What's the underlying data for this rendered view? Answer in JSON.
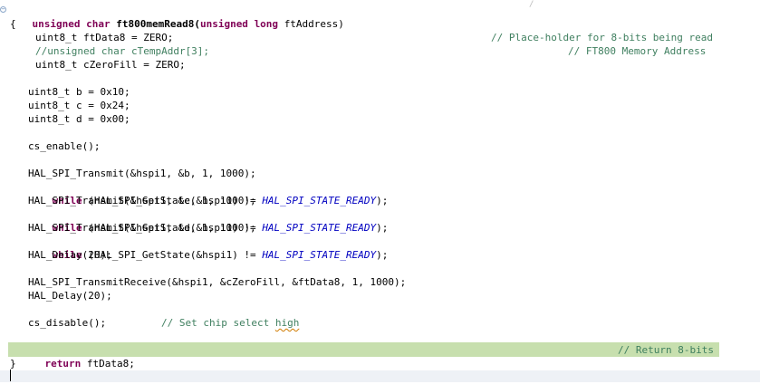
{
  "editor": {
    "fold_icon": "collapse-icon",
    "top_right_mark": "/",
    "signature": {
      "ret_kw": "unsigned",
      "ret_type": "char",
      "name": "ft800memRead8(",
      "param_kw1": "unsigned",
      "param_kw2": "long",
      "param_name": "ftAddress)"
    },
    "open_brace": "{",
    "close_brace": "}",
    "lines": {
      "l1_code": "uint8_t ftData8 = ZERO;",
      "l1_comment": "// Place-holder for 8-bits being read",
      "l2_comment_a": "//unsigned char cTempAddr[3];",
      "l2_comment_b": "// FT800 Memory Address",
      "l3_code": "uint8_t cZeroFill = ZERO;",
      "l4_code": "uint8_t b = 0x10;",
      "l5_code": "uint8_t c = 0x24;",
      "l6_code": "uint8_t d = 0x00;",
      "l7_code": "cs_enable();",
      "l8_code": "HAL_SPI_Transmit(&hspi1, &b, 1, 1000);",
      "while_kw": "while",
      "while_mid": " (HAL_SPI_GetState(&hspi1) != ",
      "while_const": "HAL_SPI_STATE_READY",
      "while_end": ");",
      "l10_code": "HAL_SPI_Transmit(&hspi1, &c, 1, 1000);",
      "l12_code": "HAL_SPI_Transmit(&hspi1, &d, 1, 1000);",
      "l14_code": "HAL_Delay(20);",
      "l15_code": "HAL_SPI_TransmitReceive(&hspi1, &cZeroFill, &ftData8, 1, 1000);",
      "l16_code": "HAL_Delay(20);",
      "l17_code": "cs_disable();",
      "l17_comment_a": "// Set chip select ",
      "l17_comment_b": "high",
      "return_kw": "return",
      "return_val": " ftData8;",
      "return_comment": "// Return 8-bits"
    }
  }
}
